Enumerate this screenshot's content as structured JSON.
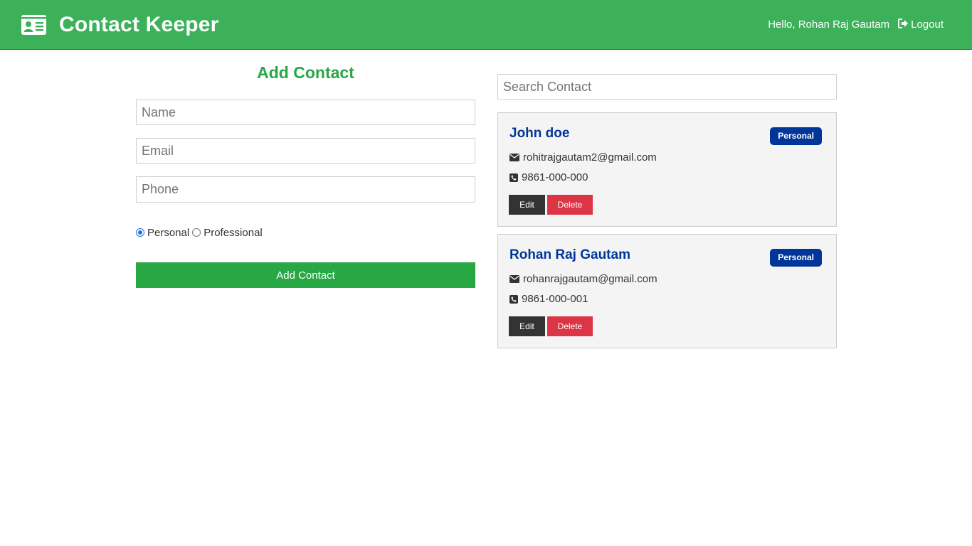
{
  "navbar": {
    "brand_icon": "id-card-icon",
    "title": "Contact Keeper",
    "greeting": "Hello, Rohan Raj Gautam",
    "logout_icon": "sign-out-icon",
    "logout_label": "Logout"
  },
  "form": {
    "title": "Add Contact",
    "name_placeholder": "Name",
    "email_placeholder": "Email",
    "phone_placeholder": "Phone",
    "type_options": [
      "Personal",
      "Professional"
    ],
    "selected_type": "Personal",
    "submit_label": "Add Contact"
  },
  "search": {
    "placeholder": "Search Contact"
  },
  "contacts": [
    {
      "name": "John doe",
      "type": "Personal",
      "email": "rohitrajgautam2@gmail.com",
      "phone": "9861-000-000",
      "edit_label": "Edit",
      "delete_label": "Delete"
    },
    {
      "name": "Rohan Raj Gautam",
      "type": "Personal",
      "email": "rohanrajgautam@gmail.com",
      "phone": "9861-000-001",
      "edit_label": "Edit",
      "delete_label": "Delete"
    }
  ],
  "colors": {
    "navbar_bg": "#3cb15a",
    "success": "#28a745",
    "primary_dark": "#003699",
    "danger": "#dc3545",
    "dark": "#333333"
  }
}
